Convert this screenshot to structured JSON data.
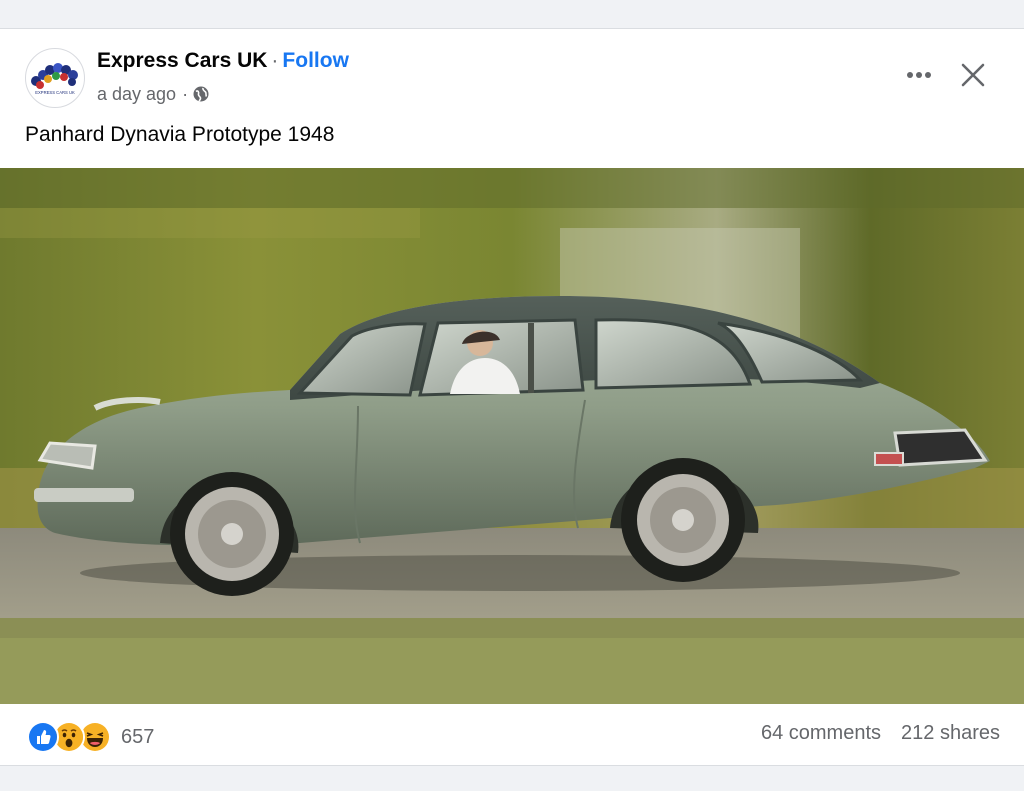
{
  "post": {
    "page_name": "Express Cars UK",
    "separator": "·",
    "follow_label": "Follow",
    "timestamp": "a day ago",
    "meta_separator": "·",
    "audience_icon": "globe-icon",
    "caption": "Panhard Dynavia Prototype 1948",
    "avatar_text": "EXPRESS CARS UK"
  },
  "header_actions": {
    "more_icon": "more-horizontal-icon",
    "close_icon": "close-icon"
  },
  "engagement": {
    "reactions": [
      "like",
      "wow",
      "haha"
    ],
    "reaction_count": "657",
    "comments": "64 comments",
    "shares": "212 shares"
  },
  "colors": {
    "accent": "#1877f2",
    "secondary_text": "#65676b",
    "primary_text": "#050505",
    "card_bg": "#ffffff",
    "page_bg": "#f0f2f5"
  }
}
